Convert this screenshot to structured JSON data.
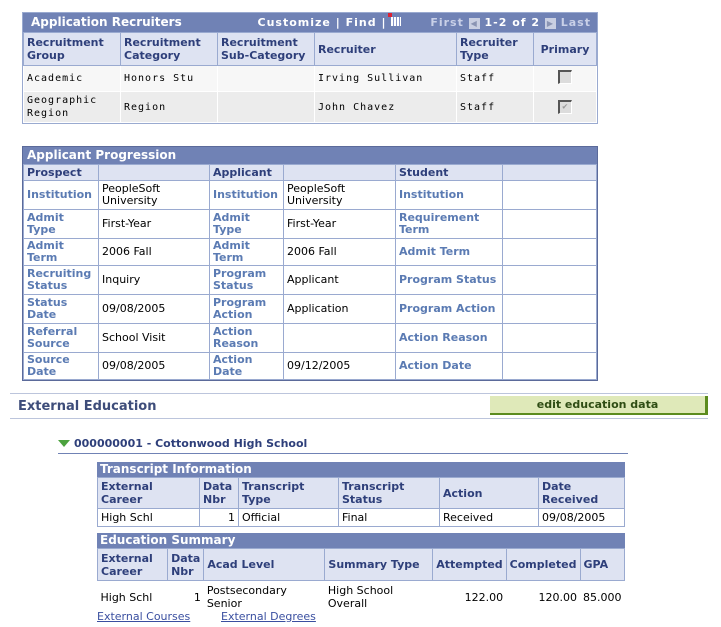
{
  "recruiters": {
    "title": "Application Recruiters",
    "customize": "Customize",
    "find": "Find",
    "sep": "|",
    "first": "First",
    "range": "1-2 of 2",
    "last": "Last",
    "columns": [
      "Recruitment Group",
      "Recruitment Category",
      "Recruitment Sub-Category",
      "Recruiter",
      "Recruiter Type",
      "Primary"
    ],
    "rows": [
      {
        "group": "Academic",
        "category": "Honors Stu",
        "subcategory": "",
        "recruiter": "Irving Sullivan",
        "type": "Staff",
        "primary": false
      },
      {
        "group": "Geographic Region",
        "category": "Region",
        "subcategory": "",
        "recruiter": "John Chavez",
        "type": "Staff",
        "primary": true
      }
    ]
  },
  "progression": {
    "title": "Applicant Progression",
    "headers": [
      "Prospect",
      "",
      "Applicant",
      "",
      "Student",
      ""
    ],
    "rows": [
      [
        "Institution",
        "PeopleSoft University",
        "Institution",
        "PeopleSoft University",
        "Institution",
        ""
      ],
      [
        "Admit Type",
        "First-Year",
        "Admit Type",
        "First-Year",
        "Requirement Term",
        ""
      ],
      [
        "Admit Term",
        "2006 Fall",
        "Admit Term",
        "2006 Fall",
        "Admit Term",
        ""
      ],
      [
        "Recruiting Status",
        "Inquiry",
        "Program Status",
        "Applicant",
        "Program Status",
        ""
      ],
      [
        "Status Date",
        "09/08/2005",
        "Program Action",
        "Application",
        "Program Action",
        ""
      ],
      [
        "Referral Source",
        "School Visit",
        "Action Reason",
        "",
        "Action Reason",
        ""
      ],
      [
        "Source Date",
        "09/08/2005",
        "Action Date",
        "09/12/2005",
        "Action Date",
        ""
      ]
    ]
  },
  "external_education": {
    "title": "External Education",
    "edit_button": "edit education data",
    "school": "000000001 - Cottonwood High School",
    "transcript": {
      "title": "Transcript Information",
      "columns": [
        "External Career",
        "Data Nbr",
        "Transcript Type",
        "Transcript Status",
        "Action",
        "Date Received"
      ],
      "rows": [
        [
          "High Schl",
          "1",
          "Official",
          "Final",
          "Received",
          "09/08/2005"
        ]
      ]
    },
    "summary": {
      "title": "Education Summary",
      "columns": [
        "External Career",
        "Data Nbr",
        "Acad Level",
        "Summary Type",
        "Attempted",
        "Completed",
        "GPA"
      ],
      "rows": [
        [
          "High Schl",
          "1",
          "Postsecondary Senior",
          "High School Overall",
          "122.00",
          "120.00",
          "85.000"
        ]
      ]
    },
    "links": [
      "External Courses",
      "External Degrees"
    ]
  }
}
